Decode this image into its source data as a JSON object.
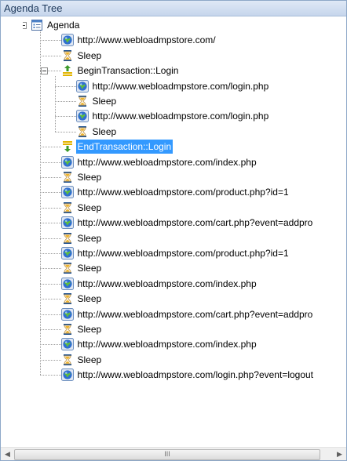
{
  "panel": {
    "title": "Agenda Tree"
  },
  "tree": {
    "root": {
      "label": "Agenda",
      "icon": "agenda-icon"
    },
    "items": [
      {
        "label": "http://www.webloadmpstore.com/",
        "icon": "globe-icon",
        "level": 1
      },
      {
        "label": "Sleep",
        "icon": "hourglass-icon",
        "level": 1
      },
      {
        "label": "BeginTransaction::Login",
        "icon": "begin-transaction-icon",
        "level": 1,
        "expanded": true
      },
      {
        "label": "http://www.webloadmpstore.com/login.php",
        "icon": "globe-icon",
        "level": 2
      },
      {
        "label": "Sleep",
        "icon": "hourglass-icon",
        "level": 2
      },
      {
        "label": "http://www.webloadmpstore.com/login.php",
        "icon": "globe-icon",
        "level": 2
      },
      {
        "label": "Sleep",
        "icon": "hourglass-icon",
        "level": 2
      },
      {
        "label": "EndTransaction::Login",
        "icon": "end-transaction-icon",
        "level": 1,
        "selected": true
      },
      {
        "label": "http://www.webloadmpstore.com/index.php",
        "icon": "globe-icon",
        "level": 1
      },
      {
        "label": "Sleep",
        "icon": "hourglass-icon",
        "level": 1
      },
      {
        "label": "http://www.webloadmpstore.com/product.php?id=1",
        "icon": "globe-icon",
        "level": 1
      },
      {
        "label": "Sleep",
        "icon": "hourglass-icon",
        "level": 1
      },
      {
        "label": "http://www.webloadmpstore.com/cart.php?event=addpro",
        "icon": "globe-icon",
        "level": 1
      },
      {
        "label": "Sleep",
        "icon": "hourglass-icon",
        "level": 1
      },
      {
        "label": "http://www.webloadmpstore.com/product.php?id=1",
        "icon": "globe-icon",
        "level": 1
      },
      {
        "label": "Sleep",
        "icon": "hourglass-icon",
        "level": 1
      },
      {
        "label": "http://www.webloadmpstore.com/index.php",
        "icon": "globe-icon",
        "level": 1
      },
      {
        "label": "Sleep",
        "icon": "hourglass-icon",
        "level": 1
      },
      {
        "label": "http://www.webloadmpstore.com/cart.php?event=addpro",
        "icon": "globe-icon",
        "level": 1
      },
      {
        "label": "Sleep",
        "icon": "hourglass-icon",
        "level": 1
      },
      {
        "label": "http://www.webloadmpstore.com/index.php",
        "icon": "globe-icon",
        "level": 1
      },
      {
        "label": "Sleep",
        "icon": "hourglass-icon",
        "level": 1
      },
      {
        "label": "http://www.webloadmpstore.com/login.php?event=logout",
        "icon": "globe-icon",
        "level": 1
      }
    ]
  },
  "scrollbar": {
    "left_arrow": "◀",
    "right_arrow": "▶",
    "grip": "III"
  }
}
